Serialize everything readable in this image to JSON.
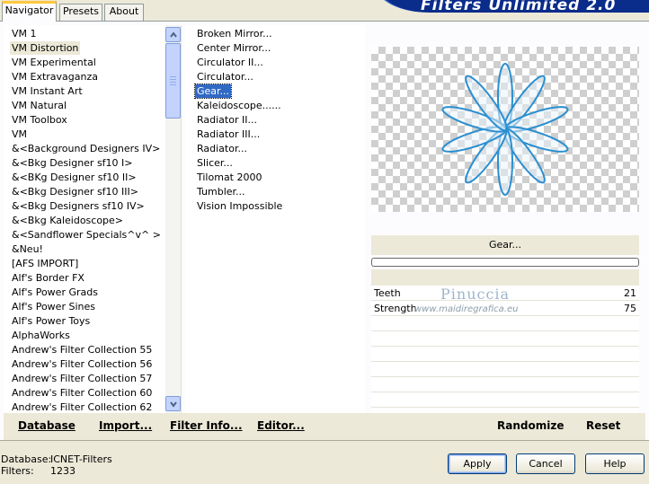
{
  "header": {
    "title": "Filters Unlimited 2.0"
  },
  "tabs": [
    {
      "label": "Navigator",
      "active": true
    },
    {
      "label": "Presets",
      "active": false
    },
    {
      "label": "About",
      "active": false
    }
  ],
  "categories": [
    "VM 1",
    "VM Distortion",
    "VM Experimental",
    "VM Extravaganza",
    "VM Instant Art",
    "VM Natural",
    "VM Toolbox",
    "VM",
    "&<Background Designers IV>",
    "&<Bkg Designer sf10 I>",
    "&<BKg Designer sf10 II>",
    "&<Bkg Designer sf10 III>",
    "&<Bkg Designers sf10 IV>",
    "&<Bkg Kaleidoscope>",
    "&<Sandflower Specials^v^ >",
    "&Neu!",
    "[AFS IMPORT]",
    "Alf's Border FX",
    "Alf's Power Grads",
    "Alf's Power Sines",
    "Alf's Power Toys",
    "AlphaWorks",
    "Andrew's Filter Collection 55",
    "Andrew's Filter Collection 56",
    "Andrew's Filter Collection 57",
    "Andrew's Filter Collection 60",
    "Andrew's Filter Collection 62"
  ],
  "selected_category": "VM Distortion",
  "filters": [
    "Broken Mirror...",
    "Center Mirror...",
    "Circulator II...",
    "Circulator...",
    "Gear...",
    "Kaleidoscope......",
    "Radiator II...",
    "Radiator III...",
    "Radiator...",
    "Slicer...",
    "Tilomat 2000",
    "Tumbler...",
    "Vision Impossible"
  ],
  "selected_filter": "Gear...",
  "preview": {
    "filter_name": "Gear..."
  },
  "parameters": [
    {
      "name": "Teeth",
      "value": "21"
    },
    {
      "name": "Strength",
      "value": "75"
    }
  ],
  "watermark": {
    "line1": "Pinuccia",
    "line2": "www.maidiregrafica.eu"
  },
  "actions": {
    "database": "Database",
    "import": "Import...",
    "filter_info": "Filter Info...",
    "editor": "Editor...",
    "randomize": "Randomize",
    "reset": "Reset"
  },
  "status": {
    "database_label": "Database:",
    "database_value": "ICNET-Filters",
    "filters_label": "Filters:",
    "filters_value": "1233"
  },
  "buttons": {
    "apply": "Apply",
    "cancel": "Cancel",
    "help": "Help"
  },
  "colors": {
    "selection": "#316ac5",
    "accent_tab": "#ffc83c",
    "banner": "#0a2c8a",
    "petal": "#2a8fd0"
  }
}
